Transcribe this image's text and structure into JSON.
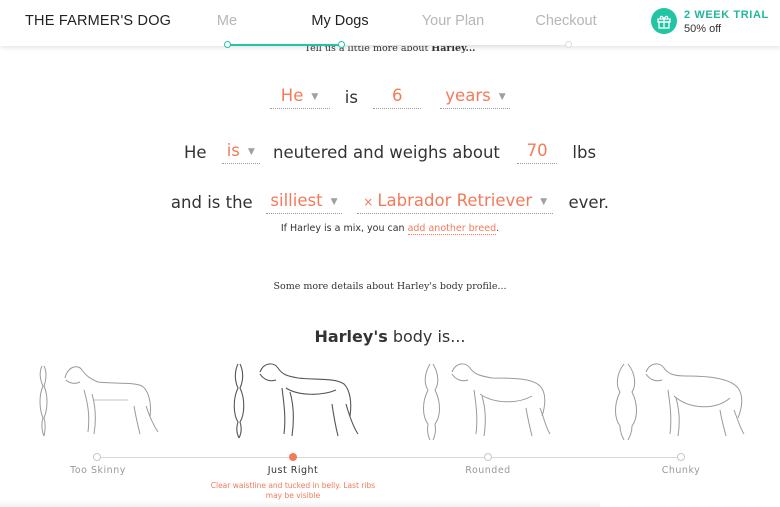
{
  "header": {
    "logo": "THE FARMER'S DOG",
    "steps": [
      {
        "label": "Me",
        "active": false
      },
      {
        "label": "My Dogs",
        "active": true
      },
      {
        "label": "Your Plan",
        "active": false
      },
      {
        "label": "Checkout",
        "active": false
      }
    ],
    "trial": {
      "title": "2 WEEK TRIAL",
      "subtitle": "50% off",
      "icon": "gift-icon"
    }
  },
  "intro": {
    "text": "Tell us a little more about ",
    "dog_name": "Harley..."
  },
  "sentence1": {
    "pronoun": "He",
    "is_text": "is",
    "age": "6",
    "unit": "years"
  },
  "sentence2": {
    "pronoun_text": "He",
    "neutered": "is",
    "middle": "neutered and weighs about",
    "weight": "70",
    "unit": "lbs"
  },
  "sentence3": {
    "prefix": "and is the",
    "adjective": "silliest",
    "breed": "Labrador Retriever",
    "suffix": "ever."
  },
  "mix_note": {
    "text": "If Harley is a mix, you can ",
    "link": "add another breed",
    "end": "."
  },
  "body_profile": {
    "intro": "Some more details about Harley's body profile...",
    "title_name": "Harley's",
    "title_rest": " body is...",
    "options": [
      {
        "label": "Too Skinny",
        "selected": false
      },
      {
        "label": "Just Right",
        "selected": true
      },
      {
        "label": "Rounded",
        "selected": false
      },
      {
        "label": "Chunky",
        "selected": false
      }
    ],
    "selected_description": "Clear waistline and tucked in belly. Last ribs may be visible"
  },
  "colors": {
    "accent": "#f47a5a",
    "brand_teal": "#21c4a3",
    "text": "#333333",
    "muted": "#9a9a9a"
  }
}
